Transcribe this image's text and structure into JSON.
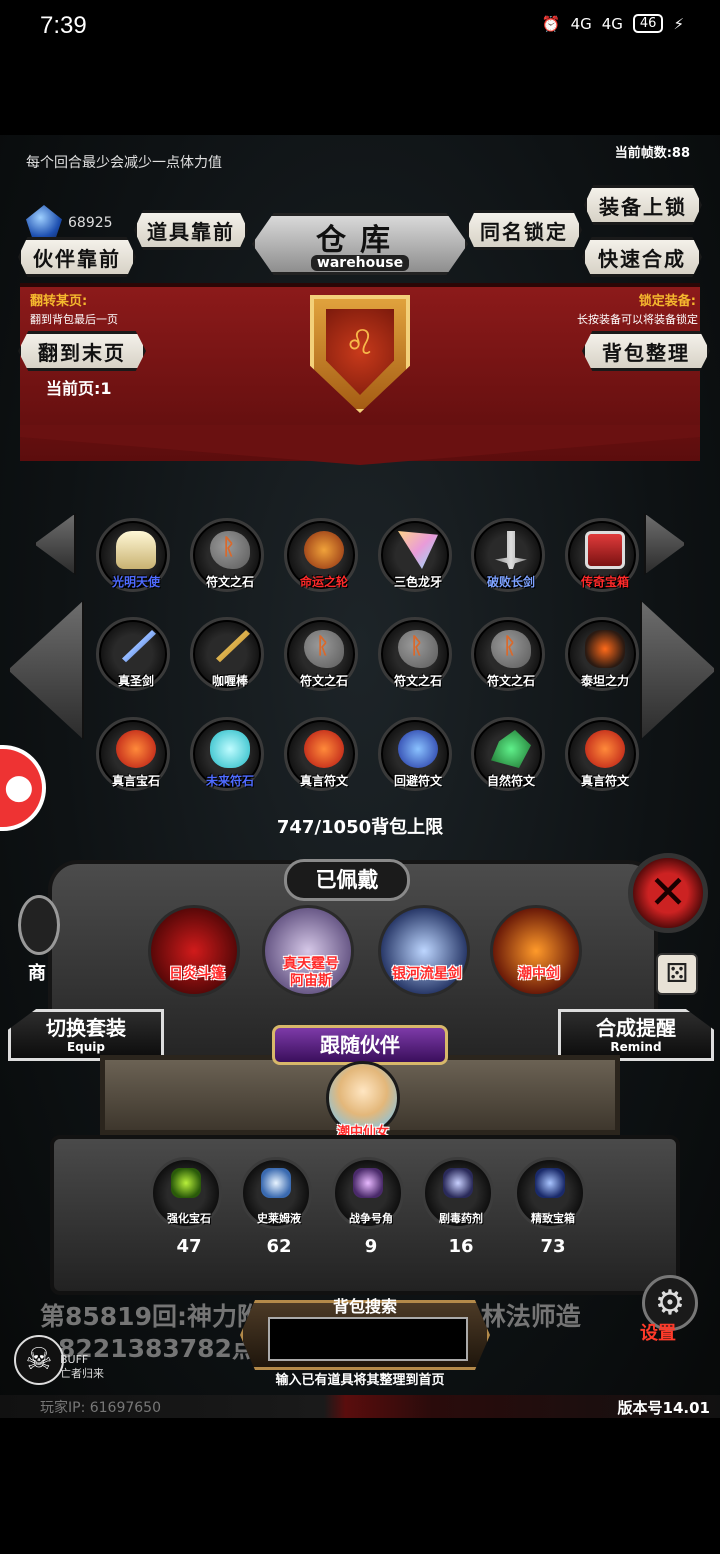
{
  "status": {
    "time": "7:39",
    "signal1": "4G",
    "signal2": "4G",
    "battery": "46"
  },
  "top": {
    "tip": "每个回合最少会减少一点体力值",
    "fps": "当前帧数:88",
    "gem_count": "68925"
  },
  "title": {
    "main": "仓库",
    "sub": "warehouse"
  },
  "buttons": {
    "items_front": "道具靠前",
    "partner_front": "伙伴靠前",
    "same_name_lock": "同名锁定",
    "equip_lock": "装备上锁",
    "quick_merge": "快速合成",
    "flip_to_end": "翻到末页",
    "bag_sort": "背包整理"
  },
  "hints": {
    "flip_title": "翻转某页:",
    "flip_desc": "翻到背包最后一页",
    "lock_title": "锁定装备:",
    "lock_desc": "长按装备可以将装备锁定"
  },
  "current_page": "当前页:1",
  "items": [
    {
      "name": "光明天使",
      "color": "#4f6bff",
      "icon": "angel-icon"
    },
    {
      "name": "符文之石",
      "color": "#ffffff",
      "icon": "rune-stone-icon"
    },
    {
      "name": "命运之轮",
      "color": "#ff2a2a",
      "icon": "fate-wheel-icon"
    },
    {
      "name": "三色龙牙",
      "color": "#ffffff",
      "icon": "dragon-fang-icon"
    },
    {
      "name": "破败长剑",
      "color": "#7ea2ff",
      "icon": "ruined-sword-icon"
    },
    {
      "name": "传奇宝箱",
      "color": "#ff2a2a",
      "icon": "legend-chest-icon"
    },
    {
      "name": "真圣剑",
      "color": "#ffffff",
      "icon": "holy-sword-icon"
    },
    {
      "name": "咖喱棒",
      "color": "#ffffff",
      "icon": "curry-stick-icon"
    },
    {
      "name": "符文之石",
      "color": "#ffffff",
      "icon": "rune-stone-icon"
    },
    {
      "name": "符文之石",
      "color": "#ffffff",
      "icon": "rune-stone-icon"
    },
    {
      "name": "符文之石",
      "color": "#ffffff",
      "icon": "rune-stone-icon"
    },
    {
      "name": "泰坦之力",
      "color": "#ffffff",
      "icon": "titan-power-icon"
    },
    {
      "name": "真言宝石",
      "color": "#ffffff",
      "icon": "mantra-gem-icon"
    },
    {
      "name": "未来符石",
      "color": "#4f6bff",
      "icon": "future-rune-icon"
    },
    {
      "name": "真言符文",
      "color": "#ffffff",
      "icon": "mantra-rune-icon"
    },
    {
      "name": "回避符文",
      "color": "#ffffff",
      "icon": "evasion-rune-icon"
    },
    {
      "name": "自然符文",
      "color": "#ffffff",
      "icon": "nature-rune-icon"
    },
    {
      "name": "真言符文",
      "color": "#ffffff",
      "icon": "mantra-rune-icon"
    }
  ],
  "capacity": "747/1050背包上限",
  "equipped": {
    "title": "已佩戴",
    "items": [
      {
        "name": "日炎斗篷",
        "icon": "sun-cloak-icon"
      },
      {
        "name": "真天霆号\n阿宙斯",
        "icon": "zeus-icon"
      },
      {
        "name": "银河流星剑",
        "icon": "galaxy-sword-icon"
      },
      {
        "name": "潮中剑",
        "icon": "tide-sword-icon"
      }
    ]
  },
  "switch_set": {
    "main": "切换套装",
    "en": "Equip"
  },
  "merge_remind": {
    "main": "合成提醒",
    "en": "Remind"
  },
  "follow": {
    "title": "跟随伙伴",
    "partner": "潮中仙女"
  },
  "consumables": [
    {
      "name": "强化宝石",
      "count": "47",
      "icon": "enhance-gem-icon"
    },
    {
      "name": "史莱姆液",
      "count": "62",
      "icon": "slime-potion-icon"
    },
    {
      "name": "战争号角",
      "count": "9",
      "icon": "war-horn-icon"
    },
    {
      "name": "剧毒药剂",
      "count": "16",
      "icon": "poison-potion-icon"
    },
    {
      "name": "精致宝箱",
      "count": "73",
      "icon": "fine-chest-icon"
    }
  ],
  "ticker": {
    "line1": "第85819回:神力附",
    "line1_right": "林法师造",
    "line2": "8221383782点伤"
  },
  "search": {
    "label": "背包搜索",
    "placeholder": "",
    "hint": "输入已有道具将其整理到首页"
  },
  "buff": {
    "label": "BUFF",
    "sub": "亡者归来"
  },
  "shop_label": "商",
  "settings_label": "设置",
  "player_ip": "玩家IP: 61697650",
  "version": "版本号14.01"
}
